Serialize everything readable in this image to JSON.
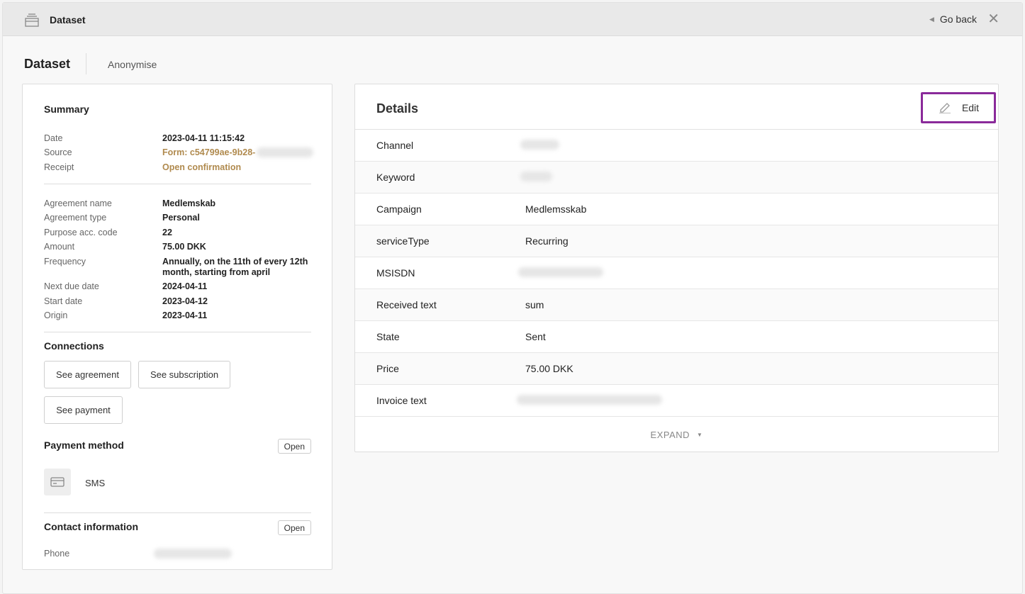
{
  "topbar": {
    "title": "Dataset",
    "go_back": "Go back"
  },
  "page": {
    "title": "Dataset",
    "tab": "Anonymise"
  },
  "summary": {
    "heading": "Summary",
    "group1": [
      {
        "label": "Date",
        "value": "2023-04-11 11:15:42"
      },
      {
        "label": "Source",
        "value": "Form: c54799ae-9b28-"
      },
      {
        "label": "Receipt",
        "value": "Open confirmation"
      }
    ],
    "group2": [
      {
        "label": "Agreement name",
        "value": "Medlemskab"
      },
      {
        "label": "Agreement type",
        "value": "Personal"
      },
      {
        "label": "Purpose acc. code",
        "value": "22"
      },
      {
        "label": "Amount",
        "value": "75.00 DKK"
      },
      {
        "label": "Frequency",
        "value": "Annually, on the 11th of every 12th month, starting from april"
      },
      {
        "label": "Next due date",
        "value": "2024-04-11"
      },
      {
        "label": "Start date",
        "value": "2023-04-12"
      },
      {
        "label": "Origin",
        "value": "2023-04-11"
      }
    ]
  },
  "connections": {
    "heading": "Connections",
    "see_agreement": "See agreement",
    "see_subscription": "See subscription",
    "see_payment": "See payment"
  },
  "payment_method": {
    "heading": "Payment method",
    "open": "Open",
    "method": "SMS"
  },
  "contact": {
    "heading": "Contact information",
    "open": "Open",
    "phone_label": "Phone"
  },
  "details": {
    "title": "Details",
    "edit": "Edit",
    "rows": [
      {
        "label": "Channel",
        "value": ""
      },
      {
        "label": "Keyword",
        "value": ""
      },
      {
        "label": "Campaign",
        "value": "Medlemsskab"
      },
      {
        "label": "serviceType",
        "value": "Recurring"
      },
      {
        "label": "MSISDN",
        "value": ""
      },
      {
        "label": "Received text",
        "value": "sum"
      },
      {
        "label": "State",
        "value": "Sent"
      },
      {
        "label": "Price",
        "value": "75.00 DKK"
      },
      {
        "label": "Invoice text",
        "value": ""
      }
    ],
    "expand": "EXPAND"
  },
  "colors": {
    "accent_link": "#b08a4e",
    "edit_highlight": "#8a2a9a"
  }
}
